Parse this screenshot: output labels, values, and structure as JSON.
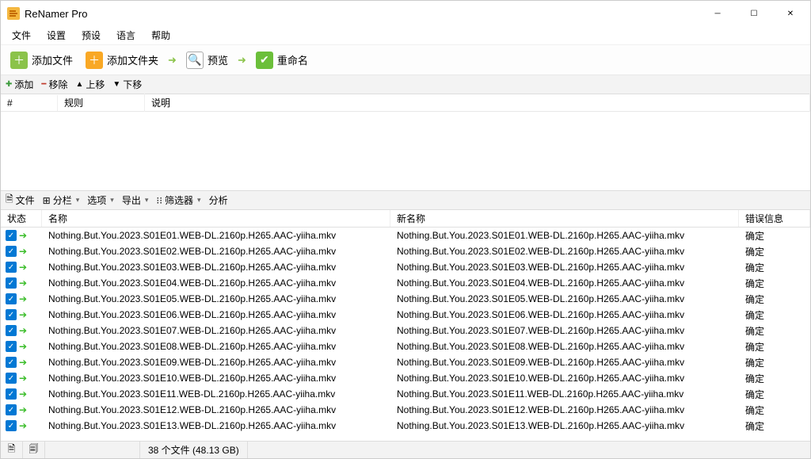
{
  "window": {
    "title": "ReNamer Pro"
  },
  "menu": {
    "file": "文件",
    "settings": "设置",
    "presets": "预设",
    "language": "语言",
    "help": "帮助"
  },
  "toolbar": {
    "add_files": "添加文件",
    "add_folders": "添加文件夹",
    "preview": "预览",
    "rename": "重命名"
  },
  "rules_toolbar": {
    "add": "添加",
    "remove": "移除",
    "move_up": "上移",
    "move_down": "下移"
  },
  "rules_columns": {
    "num": "#",
    "rule": "规则",
    "desc": "说明"
  },
  "files_toolbar": {
    "files": "文件",
    "columns": "分栏",
    "options": "选项",
    "export": "导出",
    "filter": "筛选器",
    "analyze": "分析"
  },
  "files_columns": {
    "state": "状态",
    "name": "名称",
    "newname": "新名称",
    "error": "错误信息"
  },
  "status_ok": "确定",
  "files": [
    {
      "name": "Nothing.But.You.2023.S01E01.WEB-DL.2160p.H265.AAC-yiiha.mkv",
      "newname": "Nothing.But.You.2023.S01E01.WEB-DL.2160p.H265.AAC-yiiha.mkv"
    },
    {
      "name": "Nothing.But.You.2023.S01E02.WEB-DL.2160p.H265.AAC-yiiha.mkv",
      "newname": "Nothing.But.You.2023.S01E02.WEB-DL.2160p.H265.AAC-yiiha.mkv"
    },
    {
      "name": "Nothing.But.You.2023.S01E03.WEB-DL.2160p.H265.AAC-yiiha.mkv",
      "newname": "Nothing.But.You.2023.S01E03.WEB-DL.2160p.H265.AAC-yiiha.mkv"
    },
    {
      "name": "Nothing.But.You.2023.S01E04.WEB-DL.2160p.H265.AAC-yiiha.mkv",
      "newname": "Nothing.But.You.2023.S01E04.WEB-DL.2160p.H265.AAC-yiiha.mkv"
    },
    {
      "name": "Nothing.But.You.2023.S01E05.WEB-DL.2160p.H265.AAC-yiiha.mkv",
      "newname": "Nothing.But.You.2023.S01E05.WEB-DL.2160p.H265.AAC-yiiha.mkv"
    },
    {
      "name": "Nothing.But.You.2023.S01E06.WEB-DL.2160p.H265.AAC-yiiha.mkv",
      "newname": "Nothing.But.You.2023.S01E06.WEB-DL.2160p.H265.AAC-yiiha.mkv"
    },
    {
      "name": "Nothing.But.You.2023.S01E07.WEB-DL.2160p.H265.AAC-yiiha.mkv",
      "newname": "Nothing.But.You.2023.S01E07.WEB-DL.2160p.H265.AAC-yiiha.mkv"
    },
    {
      "name": "Nothing.But.You.2023.S01E08.WEB-DL.2160p.H265.AAC-yiiha.mkv",
      "newname": "Nothing.But.You.2023.S01E08.WEB-DL.2160p.H265.AAC-yiiha.mkv"
    },
    {
      "name": "Nothing.But.You.2023.S01E09.WEB-DL.2160p.H265.AAC-yiiha.mkv",
      "newname": "Nothing.But.You.2023.S01E09.WEB-DL.2160p.H265.AAC-yiiha.mkv"
    },
    {
      "name": "Nothing.But.You.2023.S01E10.WEB-DL.2160p.H265.AAC-yiiha.mkv",
      "newname": "Nothing.But.You.2023.S01E10.WEB-DL.2160p.H265.AAC-yiiha.mkv"
    },
    {
      "name": "Nothing.But.You.2023.S01E11.WEB-DL.2160p.H265.AAC-yiiha.mkv",
      "newname": "Nothing.But.You.2023.S01E11.WEB-DL.2160p.H265.AAC-yiiha.mkv"
    },
    {
      "name": "Nothing.But.You.2023.S01E12.WEB-DL.2160p.H265.AAC-yiiha.mkv",
      "newname": "Nothing.But.You.2023.S01E12.WEB-DL.2160p.H265.AAC-yiiha.mkv"
    },
    {
      "name": "Nothing.But.You.2023.S01E13.WEB-DL.2160p.H265.AAC-yiiha.mkv",
      "newname": "Nothing.But.You.2023.S01E13.WEB-DL.2160p.H265.AAC-yiiha.mkv"
    }
  ],
  "statusbar": {
    "summary": "38 个文件 (48.13 GB)"
  }
}
